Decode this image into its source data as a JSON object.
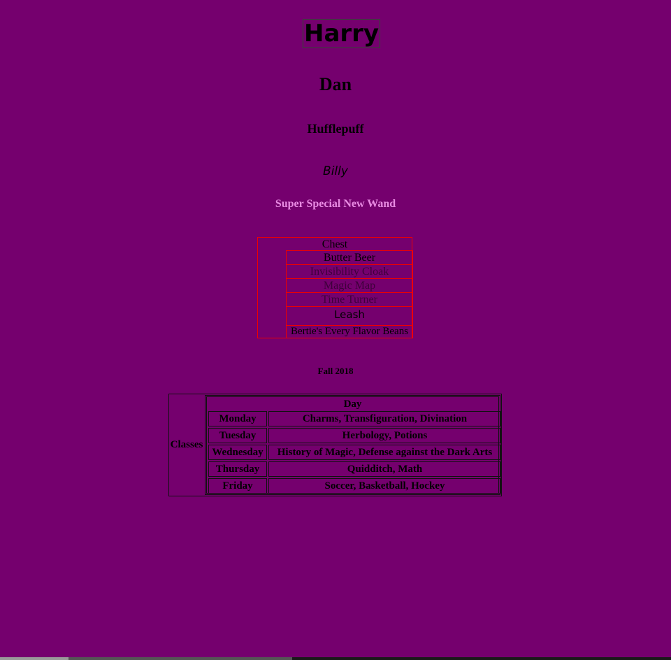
{
  "header": {
    "title": "Harry",
    "subtitle": "Dan",
    "house": "Hufflepuff",
    "script_name": "Billy",
    "wand_label": "Super Special New Wand"
  },
  "chest": {
    "heading": "Chest",
    "items": [
      "Butter Beer",
      "Invisibility Cloak",
      "Magic Map",
      "Time Turner",
      "Leash",
      "Bertie's Every Flavor Beans"
    ]
  },
  "schedule": {
    "term": "Fall 2018",
    "row_header": "Classes",
    "column_header": "Day",
    "rows": [
      {
        "day": "Monday",
        "subjects": "Charms, Transfiguration, Divination"
      },
      {
        "day": "Tuesday",
        "subjects": "Herbology, Potions"
      },
      {
        "day": "Wednesday",
        "subjects": "History of Magic, Defense against the Dark Arts"
      },
      {
        "day": "Thursday",
        "subjects": "Quidditch, Math"
      },
      {
        "day": "Friday",
        "subjects": "Soccer, Basketball, Hockey"
      }
    ]
  },
  "colors": {
    "background": "#75006e",
    "chest_border": "#e00000",
    "wand_text": "#e88ae2"
  }
}
